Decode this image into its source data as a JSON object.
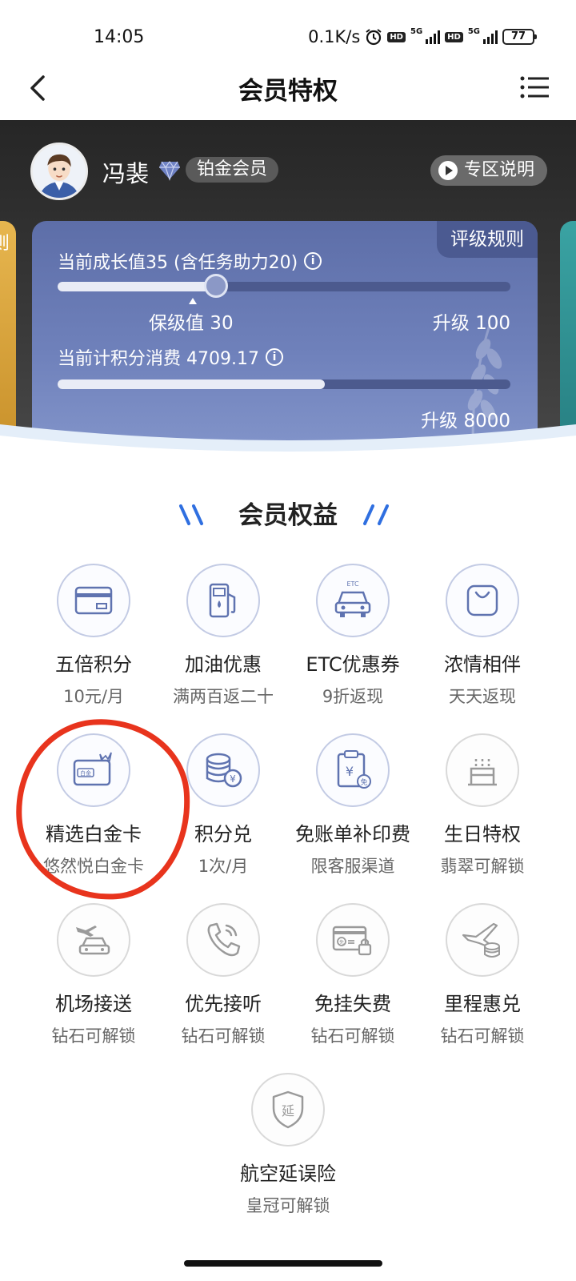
{
  "status_bar": {
    "time": "14:05",
    "net_speed": "0.1K/s",
    "battery": "77",
    "icons": [
      "alarm-icon",
      "hd-icon",
      "5g-signal-icon",
      "hd-icon",
      "5g-signal-icon",
      "battery-icon"
    ]
  },
  "nav": {
    "title": "会员特权",
    "back_icon": "back-chevron-icon",
    "menu_icon": "list-menu-icon"
  },
  "profile": {
    "name": "冯裴",
    "level": "铂金会员",
    "zone_button": "专区说明"
  },
  "cards": {
    "left_peek_text": "则",
    "main": {
      "rules_tab": "评级规则",
      "growth_text": "当前成长值35 (含任务助力20)",
      "growth_progress": 0.35,
      "keep_label": "保级值 30",
      "upgrade_growth_label": "升级 100",
      "spend_text": "当前计积分消费 4709.17",
      "spend_progress": 0.59,
      "upgrade_spend_label": "升级 8000",
      "info_icon": "i"
    }
  },
  "section": {
    "title": "会员权益"
  },
  "benefits": [
    {
      "name": "五倍积分",
      "sub": "10元/月",
      "icon": "card-icon",
      "locked": false
    },
    {
      "name": "加油优惠",
      "sub": "满两百返二十",
      "icon": "fuel-pump-icon",
      "locked": false
    },
    {
      "name": "ETC优惠券",
      "sub": "9折返现",
      "icon": "etc-car-icon",
      "locked": false,
      "icon_text": "ETC"
    },
    {
      "name": "浓情相伴",
      "sub": "天天返现",
      "icon": "shopping-bag-icon",
      "locked": false
    },
    {
      "name": "精选白金卡",
      "sub": "悠然悦白金卡",
      "icon": "platinum-card-icon",
      "locked": false,
      "icon_text": "白金"
    },
    {
      "name": "积分兑",
      "sub": "1次/月",
      "icon": "coin-stack-icon",
      "locked": false
    },
    {
      "name": "免账单补印费",
      "sub": "限客服渠道",
      "icon": "bill-icon",
      "locked": false,
      "icon_text": "免"
    },
    {
      "name": "生日特权",
      "sub": "翡翠可解锁",
      "icon": "birthday-cake-icon",
      "locked": true
    },
    {
      "name": "机场接送",
      "sub": "钻石可解锁",
      "icon": "airport-car-icon",
      "locked": true
    },
    {
      "name": "优先接听",
      "sub": "钻石可解锁",
      "icon": "phone-icon",
      "locked": true
    },
    {
      "name": "免挂失费",
      "sub": "钻石可解锁",
      "icon": "card-lock-icon",
      "locked": true,
      "icon_text": "免"
    },
    {
      "name": "里程惠兑",
      "sub": "钻石可解锁",
      "icon": "plane-coin-icon",
      "locked": true
    },
    {
      "name": "航空延误险",
      "sub": "皇冠可解锁",
      "icon": "shield-icon",
      "locked": true,
      "icon_text": "延"
    }
  ],
  "colors": {
    "accent_blue": "#2f6fe0",
    "card_blue": "#6f81bb",
    "highlight_red": "#e8341d"
  }
}
